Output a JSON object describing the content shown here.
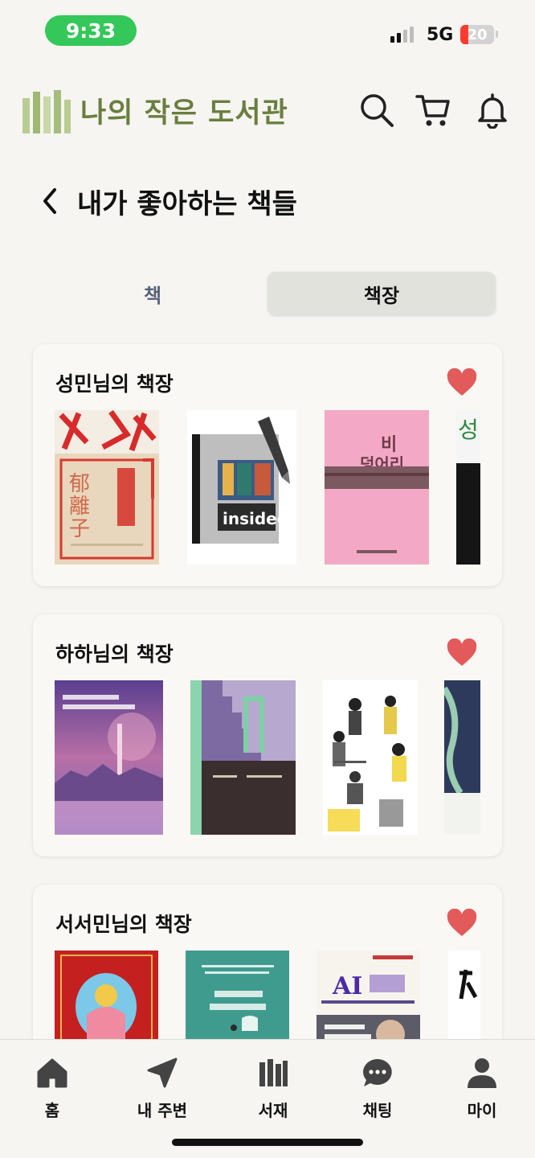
{
  "status_bar": {
    "time": "9:33",
    "network": "5G",
    "battery": "20",
    "battery_level": 0.2
  },
  "header": {
    "app_title": "나의 작은 도서관",
    "logo_icon": "bookshelf-logo-icon",
    "actions": [
      "search-icon",
      "cart-icon",
      "bell-icon"
    ],
    "brand_color": "#6a7e3f"
  },
  "page": {
    "title": "내가 좋아하는 책들"
  },
  "tabs": [
    {
      "label": "책",
      "selected": false
    },
    {
      "label": "책장",
      "selected": true
    }
  ],
  "shelves": [
    {
      "title": "성민님의 책장",
      "liked": true,
      "books": [
        "",
        "",
        "",
        ""
      ]
    },
    {
      "title": "하하님의 책장",
      "liked": true,
      "books": [
        "",
        "",
        "",
        ""
      ]
    },
    {
      "title": "서서민님의 책장",
      "liked": true,
      "books": [
        "",
        "",
        "",
        ""
      ]
    }
  ],
  "bottom_nav": [
    {
      "label": "홈",
      "icon": "home-icon"
    },
    {
      "label": "내 주변",
      "icon": "location-arrow-icon"
    },
    {
      "label": "서재",
      "icon": "library-icon"
    },
    {
      "label": "채팅",
      "icon": "chat-bubble-icon"
    },
    {
      "label": "마이",
      "icon": "person-icon"
    }
  ],
  "colors": {
    "heart": "#e35a5a",
    "background": "#f6f5f1",
    "card": "#f9f8f5"
  }
}
